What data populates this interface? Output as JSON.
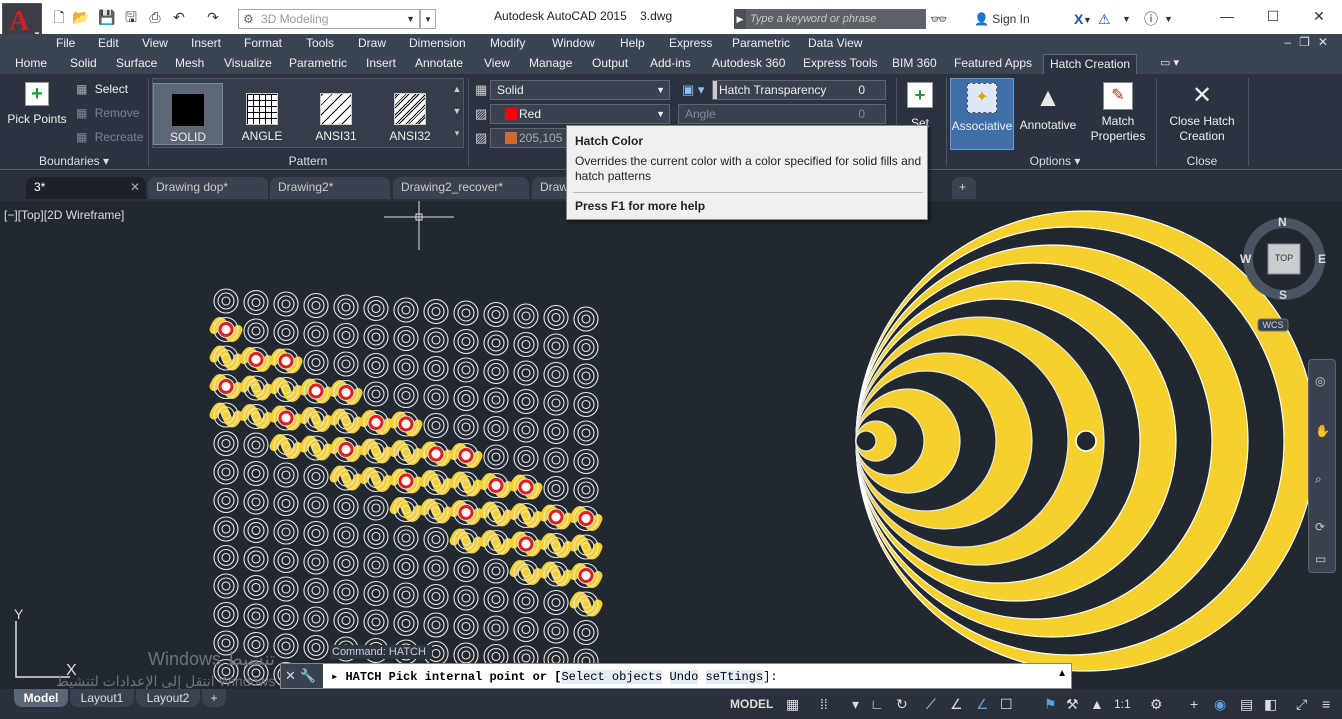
{
  "titlebar": {
    "workspace": "3D Modeling",
    "app_name": "Autodesk AutoCAD 2015",
    "file_name": "3.dwg",
    "search_placeholder": "Type a keyword or phrase",
    "sign_in": "Sign In"
  },
  "menu": [
    "File",
    "Edit",
    "View",
    "Insert",
    "Format",
    "Tools",
    "Draw",
    "Dimension",
    "Modify",
    "Window",
    "Help",
    "Express",
    "Parametric",
    "Data View"
  ],
  "ribbon_tabs": [
    "Home",
    "Solid",
    "Surface",
    "Mesh",
    "Visualize",
    "Parametric",
    "Insert",
    "Annotate",
    "View",
    "Manage",
    "Output",
    "Add-ins",
    "Autodesk 360",
    "Express Tools",
    "BIM 360",
    "Featured Apps",
    "Hatch Creation"
  ],
  "ribbon": {
    "boundaries": {
      "title": "Boundaries",
      "pick_points": "Pick Points",
      "select": "Select",
      "remove": "Remove",
      "recreate": "Recreate"
    },
    "pattern": {
      "title": "Pattern",
      "items": [
        "SOLID",
        "ANGLE",
        "ANSI31",
        "ANSI32"
      ]
    },
    "properties": {
      "type": "Solid",
      "color": "Red",
      "color_hex": "#ff0000",
      "bg_color": "205,105",
      "transparency_label": "Hatch Transparency",
      "transparency_value": "0",
      "angle_label": "Angle",
      "angle_value": "0",
      "set_origin": "Set"
    },
    "options": {
      "title": "Options",
      "associative": "Associative",
      "annotative": "Annotative",
      "match_properties": "Match Properties"
    },
    "close": {
      "title": "Close",
      "close_label": "Close Hatch Creation"
    }
  },
  "tooltip": {
    "title": "Hatch Color",
    "body": "Overrides the current color with a color specified for solid fills and hatch patterns",
    "help": "Press F1 for more help"
  },
  "file_tabs": [
    "3*",
    "Drawing dop*",
    "Drawing2*",
    "Drawing2_recover*",
    "Draw"
  ],
  "viewport": {
    "label": "[−][Top][2D Wireframe]",
    "compass": {
      "n": "N",
      "s": "S",
      "e": "E",
      "w": "W",
      "top": "TOP",
      "wcs": "WCS"
    },
    "ucs_y": "Y",
    "ucs_x": "X",
    "hatch_color": "#f6d02c"
  },
  "watermark": {
    "line1": "Windows تنشيط",
    "line2": "انتقل إلى الإعدادات لتنشيط Windows"
  },
  "command": {
    "history": "Command: HATCH",
    "prompt": "HATCH Pick internal point or [",
    "opt1": "Select objects",
    "opt2": "Undo",
    "opt3": "seTtings",
    "end": "]:"
  },
  "status": {
    "layout_tabs": [
      "Model",
      "Layout1",
      "Layout2"
    ],
    "model": "MODEL",
    "scale": "1:1"
  }
}
